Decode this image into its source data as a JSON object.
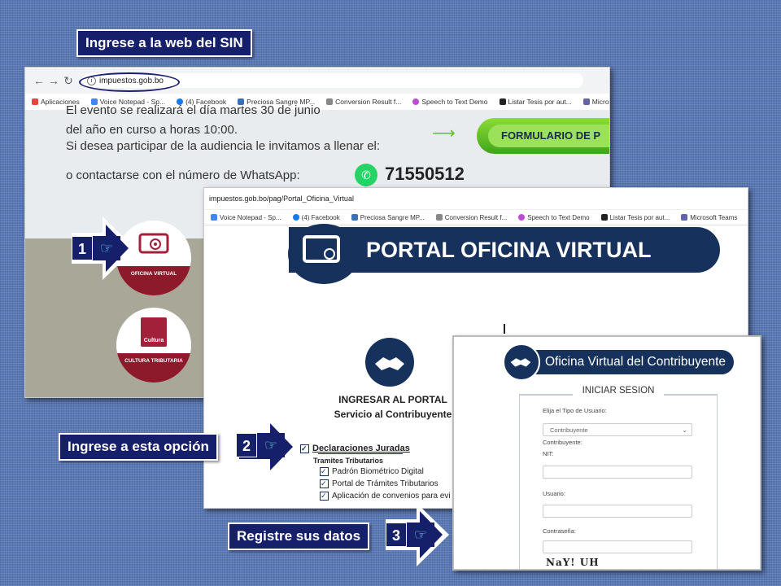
{
  "captions": {
    "step1": "Ingrese a la web del SIN",
    "step2": "Ingrese a esta opción",
    "step3": "Registre sus datos"
  },
  "steps": {
    "n1": "1",
    "n2": "2",
    "n3": "3"
  },
  "browser1": {
    "url": "impuestos.gob.bo",
    "bookmarks": [
      "Aplicaciones",
      "Voice Notepad - Sp...",
      "(4) Facebook",
      "Preciosa Sangre MP...",
      "Conversion Result f...",
      "Speech to Text Demo",
      "Listar Tesis por aut...",
      "Microsoft Teams"
    ],
    "banner_line1_prefix": "El evento se realizará el día",
    "banner_line1_highlight": "martes 30 de junio",
    "banner_line2": "del año en curso a horas 10:00.",
    "banner_line3": "Si desea participar de la audiencia le invitamos a llenar el:",
    "banner_line4": "o contactarse con el número de WhatsApp:",
    "whatsapp_number": "71550512",
    "form_button": "FORMULARIO DE P",
    "tile1_label": "OFICINA VIRTUAL",
    "tile2_label": "CULTURA TRIBUTARIA",
    "tile2_icon_text": "Cultura"
  },
  "browser2": {
    "url": "impuestos.gob.bo/pag/Portal_Oficina_Virtual",
    "bookmarks": [
      "Voice Notepad - Sp...",
      "(4) Facebook",
      "Preciosa Sangre MP...",
      "Conversion Result f...",
      "Speech to Text Demo",
      "Listar Tesis por aut...",
      "Microsoft Teams"
    ],
    "portal_title": "PORTAL OFICINA VIRTUAL",
    "ingresar": "INGRESAR AL PORTAL",
    "servicio": "Servicio al Contribuyente",
    "options": [
      "Declaraciones Juradas",
      "Tramites Tributarios",
      "Padrón Biométrico Digital",
      "Portal de Trámites Tributarios",
      "Aplicación de convenios para evi"
    ]
  },
  "browser3": {
    "title": "Oficina Virtual del Contribuyente",
    "login_title": "INICIAR SESION",
    "tipo_label": "Elija el Tipo de Usuario:",
    "tipo_value": "Contribuyente",
    "contribuyente_label": "Contribuyente:",
    "nit_label": "NIT:",
    "usuario_label": "Usuario:",
    "password_label": "Contraseña:",
    "captcha": "NaY! UH"
  },
  "colors": {
    "navy": "#16206a",
    "portal_blue": "#16325c",
    "maroon": "#8c1a2b",
    "green": "#4cb82a"
  }
}
